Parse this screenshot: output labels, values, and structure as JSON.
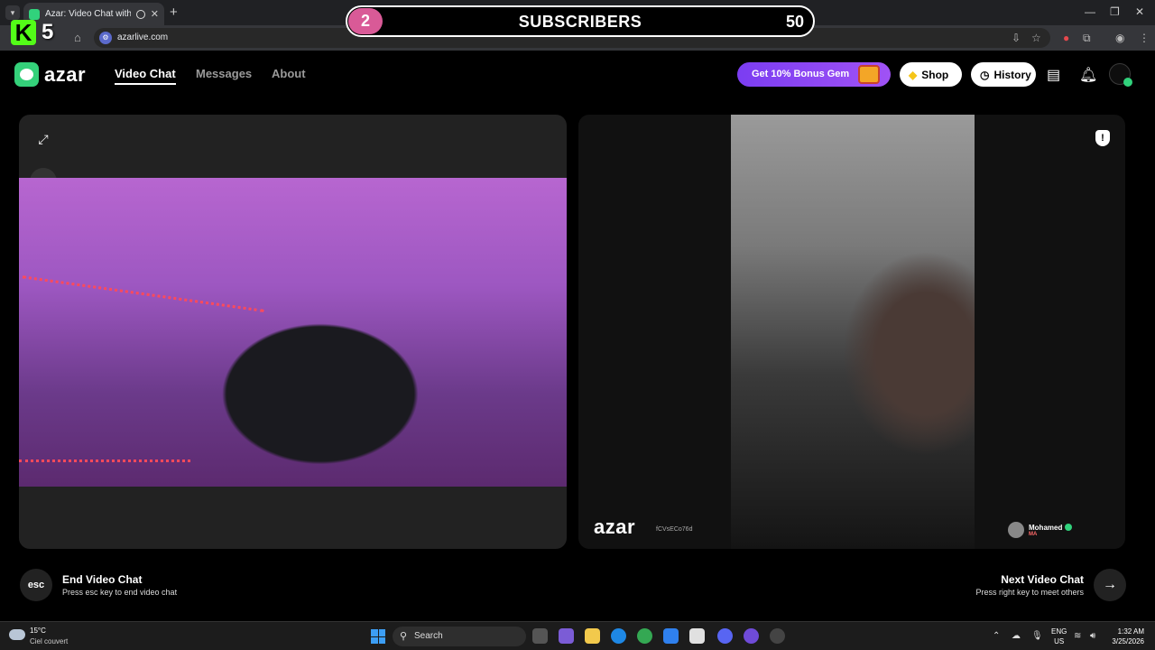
{
  "browser": {
    "tab_title": "Azar: Video Chat with New",
    "url": "azarlive.com"
  },
  "overlay": {
    "kick_logo": "K",
    "kick_count": "5",
    "sub_current": "2",
    "sub_label": "SUBSCRIBERS",
    "sub_goal": "50"
  },
  "header": {
    "logo_text": "azar",
    "nav": [
      {
        "label": "Video Chat",
        "active": true
      },
      {
        "label": "Messages",
        "active": false
      },
      {
        "label": "About",
        "active": false
      }
    ],
    "bonus_label": "Get 10% Bonus Gem",
    "shop_label": "Shop",
    "history_label": "History"
  },
  "remote": {
    "watermark": "azar",
    "watermark_id": "fCVsECo76d",
    "peer_name": "Mohamed",
    "peer_country": "MA"
  },
  "controls": {
    "esc_key": "esc",
    "end_title": "End Video Chat",
    "end_sub": "Press esc key to end video chat",
    "next_title": "Next Video Chat",
    "next_sub": "Press right key to meet others"
  },
  "taskbar": {
    "temperature": "15°C",
    "weather": "Ciel couvert",
    "search_label": "Search",
    "lang_line1": "ENG",
    "lang_line2": "US",
    "time": "1:32 AM",
    "date": "3/25/2026"
  },
  "colors": {
    "brand_green": "#34d17a",
    "bonus_purple": "#7b3df2",
    "sub_accent": "#d95a97",
    "kick_green": "#53fc18"
  }
}
